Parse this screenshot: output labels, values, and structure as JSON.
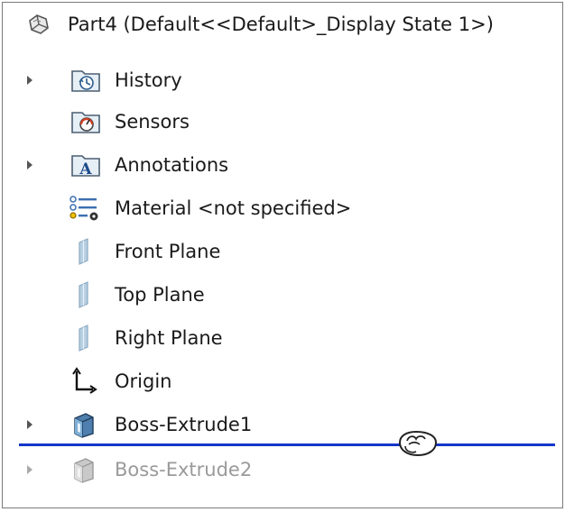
{
  "tree": {
    "root": {
      "label": "Part4  (Default<<Default>_Display State 1>)",
      "icon": "part-icon"
    },
    "items": [
      {
        "label": "History",
        "icon": "history-folder-icon",
        "expandable": true
      },
      {
        "label": "Sensors",
        "icon": "sensors-folder-icon",
        "expandable": false
      },
      {
        "label": "Annotations",
        "icon": "annotations-folder-icon",
        "expandable": true
      },
      {
        "label": "Material <not specified>",
        "icon": "material-icon",
        "expandable": false
      },
      {
        "label": "Front Plane",
        "icon": "plane-icon",
        "expandable": false
      },
      {
        "label": "Top Plane",
        "icon": "plane-icon",
        "expandable": false
      },
      {
        "label": "Right Plane",
        "icon": "plane-icon",
        "expandable": false
      },
      {
        "label": "Origin",
        "icon": "origin-icon",
        "expandable": false
      },
      {
        "label": "Boss-Extrude1",
        "icon": "extrude-icon",
        "expandable": true
      },
      {
        "label": "Boss-Extrude2",
        "icon": "extrude-icon",
        "expandable": true,
        "state": "suppressed"
      }
    ]
  },
  "rollback_bar": {
    "color": "#1436c9",
    "cursor_icon": "hand-grab-icon"
  }
}
